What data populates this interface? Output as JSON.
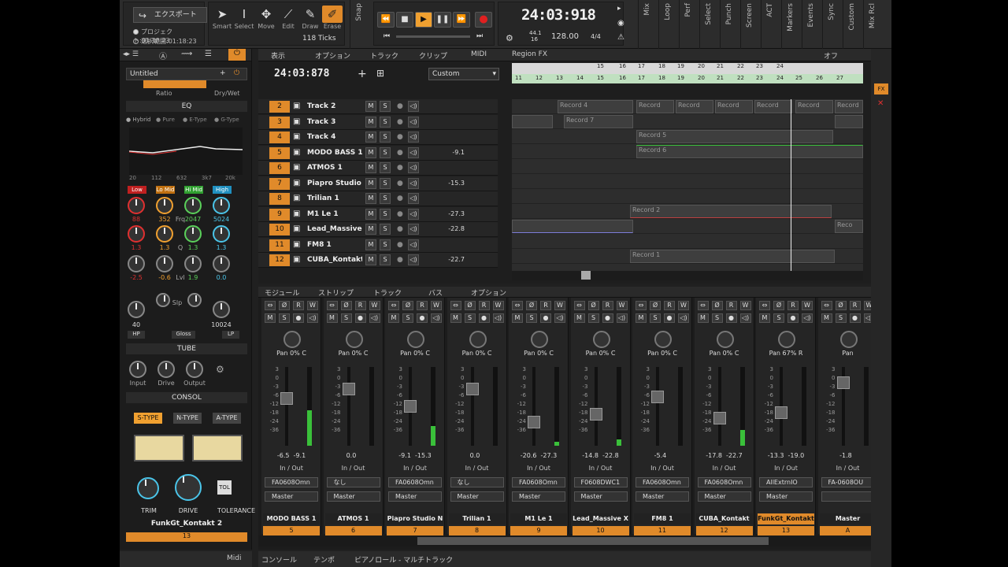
{
  "toolbar": {
    "export_label": "エクスポート",
    "project_range": "プロジェクト:01:18:23",
    "selection_range": "選択範囲:01:18:23",
    "tools": [
      "Smart",
      "Select",
      "Move",
      "Edit",
      "Draw",
      "Erase"
    ],
    "snap_label": "Snap",
    "ticks": "118 Ticks",
    "time_main": "24:03:918",
    "sample_rate": "44.1",
    "bit_depth": "16",
    "tempo": "128.00",
    "meter": "4/4",
    "side_tabs": [
      "Mix",
      "Loop",
      "Perf",
      "Select",
      "Punch",
      "Screen",
      "ACT",
      "Markers",
      "Events",
      "Sync",
      "Custom",
      "Mix Rcl"
    ]
  },
  "inspector": {
    "preset_name": "Untitled",
    "ratio_label": "Ratio",
    "drywet_label": "Dry/Wet",
    "eq_title": "EQ",
    "eq_modes": [
      "Hybrid",
      "Pure",
      "E-Type",
      "G-Type"
    ],
    "eq_freqs": [
      "20",
      "112",
      "632",
      "3k7",
      "20k"
    ],
    "bands": [
      "Low",
      "Lo Mid",
      "Hi Mid",
      "High"
    ],
    "freq_vals": [
      "88",
      "352",
      "2047",
      "5024"
    ],
    "freq_label": "Frq",
    "q_vals": [
      "1.3",
      "1.3",
      "1.3",
      "1.3"
    ],
    "q_label": "Q",
    "lvl_vals": [
      "-2.5",
      "-0.6",
      "1.9",
      "0.0"
    ],
    "lvl_label": "Lvl",
    "hp_val": "40",
    "lp_val": "10024",
    "slp_label": "Slp",
    "hp_label": "HP",
    "gloss_label": "Gloss",
    "lp_label": "LP",
    "tube_title": "TUBE",
    "tube_knobs": [
      "Input",
      "Drive",
      "Output"
    ],
    "consol_title": "CONSOL",
    "consol_types": [
      "S-TYPE",
      "N-TYPE",
      "A-TYPE"
    ],
    "consol_knobs": [
      "TRIM",
      "DRIVE",
      "TOLERANCE"
    ],
    "tol_label": "TOL",
    "track_name": "FunkGt_Kontakt 2",
    "track_num": "13"
  },
  "trackview": {
    "menus": [
      "表示",
      "オプション",
      "トラック",
      "クリップ",
      "MIDI",
      "Region FX"
    ],
    "off_label": "オフ",
    "time": "24:03:878",
    "view_preset": "Custom",
    "ruler": [
      "11",
      "12",
      "13",
      "14",
      "15",
      "16",
      "17",
      "18",
      "19",
      "20",
      "21",
      "22",
      "23",
      "24",
      "25",
      "26",
      "27"
    ],
    "ruler_top": [
      "15",
      "16",
      "17",
      "18",
      "19",
      "20",
      "21",
      "22",
      "23",
      "24"
    ],
    "tracks": [
      {
        "num": "2",
        "name": "Track 2",
        "vol": ""
      },
      {
        "num": "3",
        "name": "Track 3",
        "vol": ""
      },
      {
        "num": "4",
        "name": "Track 4",
        "vol": ""
      },
      {
        "num": "5",
        "name": "MODO BASS 1",
        "vol": "-9.1"
      },
      {
        "num": "6",
        "name": "ATMOS 1",
        "vol": ""
      },
      {
        "num": "7",
        "name": "Piapro Studio N",
        "vol": "-15.3"
      },
      {
        "num": "8",
        "name": "Trilian 1",
        "vol": ""
      },
      {
        "num": "9",
        "name": "M1 Le 1",
        "vol": "-27.3"
      },
      {
        "num": "10",
        "name": "Lead_Massive X",
        "vol": "-22.8"
      },
      {
        "num": "11",
        "name": "FM8 1",
        "vol": ""
      },
      {
        "num": "12",
        "name": "CUBA_Kontakt",
        "vol": "-22.7"
      }
    ],
    "clip_labels": {
      "record4": "Record 4",
      "record": "Record",
      "record7": "Record 7",
      "record5": "Record 5",
      "record6": "Record 6",
      "record2": "Record 2",
      "reco": "Reco",
      "record1": "Record 1"
    }
  },
  "console": {
    "menus": [
      "モジュール",
      "ストリップ",
      "トラック",
      "バス",
      "オプション"
    ],
    "pan_label": "Pan",
    "scale": [
      "3",
      "0",
      "-3",
      "-6",
      "-12",
      "-18",
      "-24",
      "-36"
    ],
    "io_label": "In / Out",
    "strips": [
      {
        "name": "MODO BASS 1",
        "num": "5",
        "pan": "0% C",
        "v1": "-6.5",
        "v2": "-9.1",
        "input": "FA0608Omn",
        "output": "Master",
        "level": 0.6,
        "meter": 0.45
      },
      {
        "name": "ATMOS 1",
        "num": "6",
        "pan": "0% C",
        "v1": "0.0",
        "v2": "",
        "input": "なし",
        "output": "Master",
        "level": 0.72,
        "meter": 0
      },
      {
        "name": "Piapro Studio N",
        "num": "7",
        "pan": "0% C",
        "v1": "-9.1",
        "v2": "-15.3",
        "input": "FA0608Omn",
        "output": "Master",
        "level": 0.5,
        "meter": 0.25
      },
      {
        "name": "Trilian 1",
        "num": "8",
        "pan": "0% C",
        "v1": "0.0",
        "v2": "",
        "input": "なし",
        "output": "Master",
        "level": 0.72,
        "meter": 0
      },
      {
        "name": "M1 Le 1",
        "num": "9",
        "pan": "0% C",
        "v1": "-20.6",
        "v2": "-27.3",
        "input": "FA0608Omn",
        "output": "Master",
        "level": 0.3,
        "meter": 0.05
      },
      {
        "name": "Lead_Massive X",
        "num": "10",
        "pan": "0% C",
        "v1": "-14.8",
        "v2": "-22.8",
        "input": "F0608DWC1",
        "output": "Master",
        "level": 0.4,
        "meter": 0.08
      },
      {
        "name": "FM8 1",
        "num": "11",
        "pan": "0% C",
        "v1": "-5.4",
        "v2": "",
        "input": "FA0608Omn",
        "output": "Master",
        "level": 0.62,
        "meter": 0
      },
      {
        "name": "CUBA_Kontakt",
        "num": "12",
        "pan": "0% C",
        "v1": "-17.8",
        "v2": "-22.7",
        "input": "FA0608Omn",
        "output": "Master",
        "level": 0.35,
        "meter": 0.2
      },
      {
        "name": "FunkGt_Kontakt",
        "num": "13",
        "pan": "67% R",
        "v1": "-13.3",
        "v2": "-19.0",
        "input": "AllExtrnIO",
        "output": "Master",
        "level": 0.42,
        "meter": 0
      },
      {
        "name": "Master",
        "num": "A",
        "pan": "",
        "v1": "-1.8",
        "v2": "",
        "input": "FA-0608OU",
        "output": "",
        "level": 0.8,
        "meter": 0
      }
    ]
  },
  "bottom_tabs": [
    "コンソール",
    "テンポ",
    "ピアノロール - マルチトラック"
  ],
  "left_bottom": {
    "browser": "Midi"
  },
  "colors": {
    "accent": "#e08a2a",
    "meter": "#3ac03a",
    "eq_high": "#4ac4e8"
  }
}
